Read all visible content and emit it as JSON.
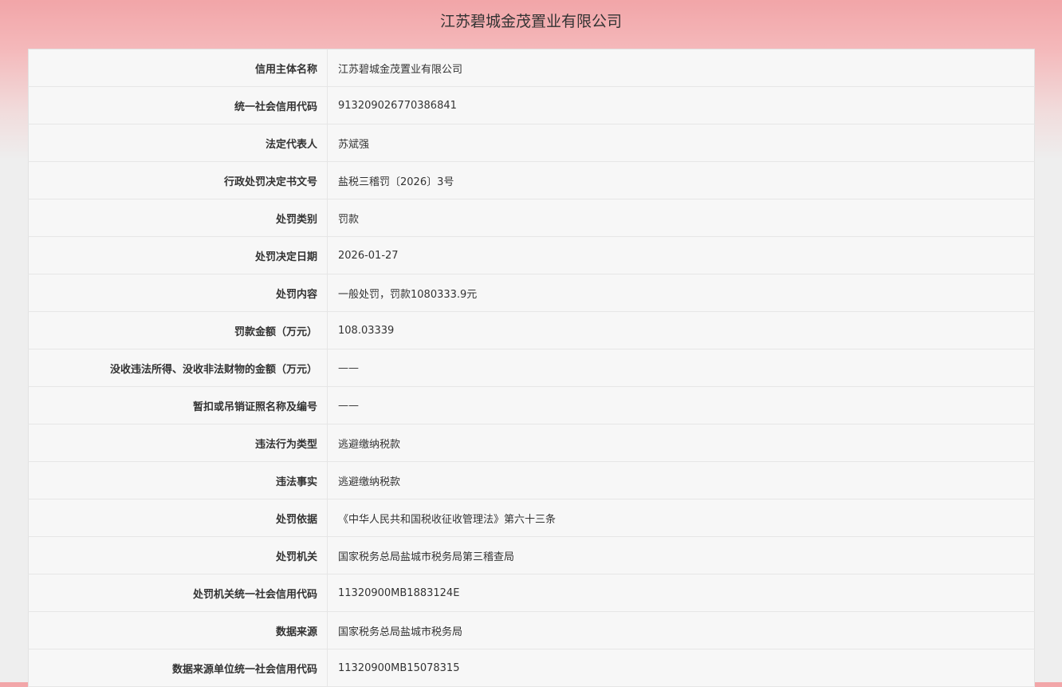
{
  "page": {
    "title": "江苏碧城金茂置业有限公司"
  },
  "rows": [
    {
      "label": "信用主体名称",
      "value": "江苏碧城金茂置业有限公司"
    },
    {
      "label": "统一社会信用代码",
      "value": "913209026770386841"
    },
    {
      "label": "法定代表人",
      "value": "苏斌强"
    },
    {
      "label": "行政处罚决定书文号",
      "value": "盐税三稽罚〔2026〕3号"
    },
    {
      "label": "处罚类别",
      "value": "罚款"
    },
    {
      "label": "处罚决定日期",
      "value": "2026-01-27"
    },
    {
      "label": "处罚内容",
      "value": "一般处罚，罚款1080333.9元"
    },
    {
      "label": "罚款金额（万元）",
      "value": "108.03339"
    },
    {
      "label": "没收违法所得、没收非法财物的金额（万元）",
      "value": "——"
    },
    {
      "label": "暂扣或吊销证照名称及编号",
      "value": "——"
    },
    {
      "label": "违法行为类型",
      "value": "逃避缴纳税款"
    },
    {
      "label": "违法事实",
      "value": "逃避缴纳税款"
    },
    {
      "label": "处罚依据",
      "value": "《中华人民共和国税收征收管理法》第六十三条"
    },
    {
      "label": "处罚机关",
      "value": "国家税务总局盐城市税务局第三稽查局"
    },
    {
      "label": "处罚机关统一社会信用代码",
      "value": "11320900MB1883124E"
    },
    {
      "label": "数据来源",
      "value": "国家税务总局盐城市税务局"
    },
    {
      "label": "数据来源单位统一社会信用代码",
      "value": "11320900MB15078315"
    }
  ]
}
